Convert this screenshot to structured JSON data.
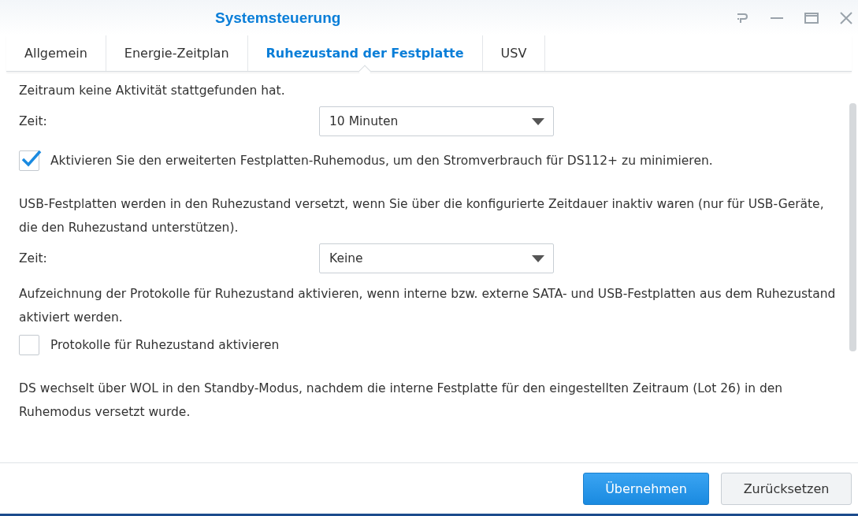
{
  "window": {
    "title": "Systemsteuerung"
  },
  "tabs": [
    {
      "label": "Allgemein",
      "selected": false
    },
    {
      "label": "Energie-Zeitplan",
      "selected": false
    },
    {
      "label": "Ruhezustand der Festplatte",
      "selected": true
    },
    {
      "label": "USV",
      "selected": false
    }
  ],
  "content": [
    {
      "kind": "text",
      "text": "Zeitraum keine Aktivität stattgefunden hat."
    },
    {
      "kind": "select",
      "label": "Zeit:",
      "value": "10 Minuten"
    },
    {
      "kind": "checkbox",
      "label": "Aktivieren Sie den erweiterten Festplatten-Ruhemodus, um den Stromverbrauch für DS112+ zu minimieren.",
      "checked": true
    },
    {
      "kind": "text",
      "text": "USB-Festplatten werden in den Ruhezustand versetzt, wenn Sie über die konfigurierte Zeitdauer inaktiv waren (nur für USB-Geräte, die den Ruhezustand unterstützen)."
    },
    {
      "kind": "select",
      "label": "Zeit:",
      "value": "Keine"
    },
    {
      "kind": "text",
      "text": "Aufzeichnung der Protokolle für Ruhezustand aktivieren, wenn interne bzw. externe SATA- und USB-Festplatten aus dem Ruhezustand aktiviert werden."
    },
    {
      "kind": "checkbox",
      "label": "Protokolle für Ruhezustand aktivieren",
      "checked": false
    },
    {
      "kind": "text",
      "text": "DS wechselt über WOL in den Standby-Modus, nachdem die interne Festplatte für den eingestellten Zeitraum (Lot 26) in den Ruhemodus versetzt wurde."
    }
  ],
  "buttons": [
    {
      "label": "Übernehmen",
      "kind": "primary"
    },
    {
      "label": "Zurücksetzen",
      "kind": "secondary"
    }
  ]
}
